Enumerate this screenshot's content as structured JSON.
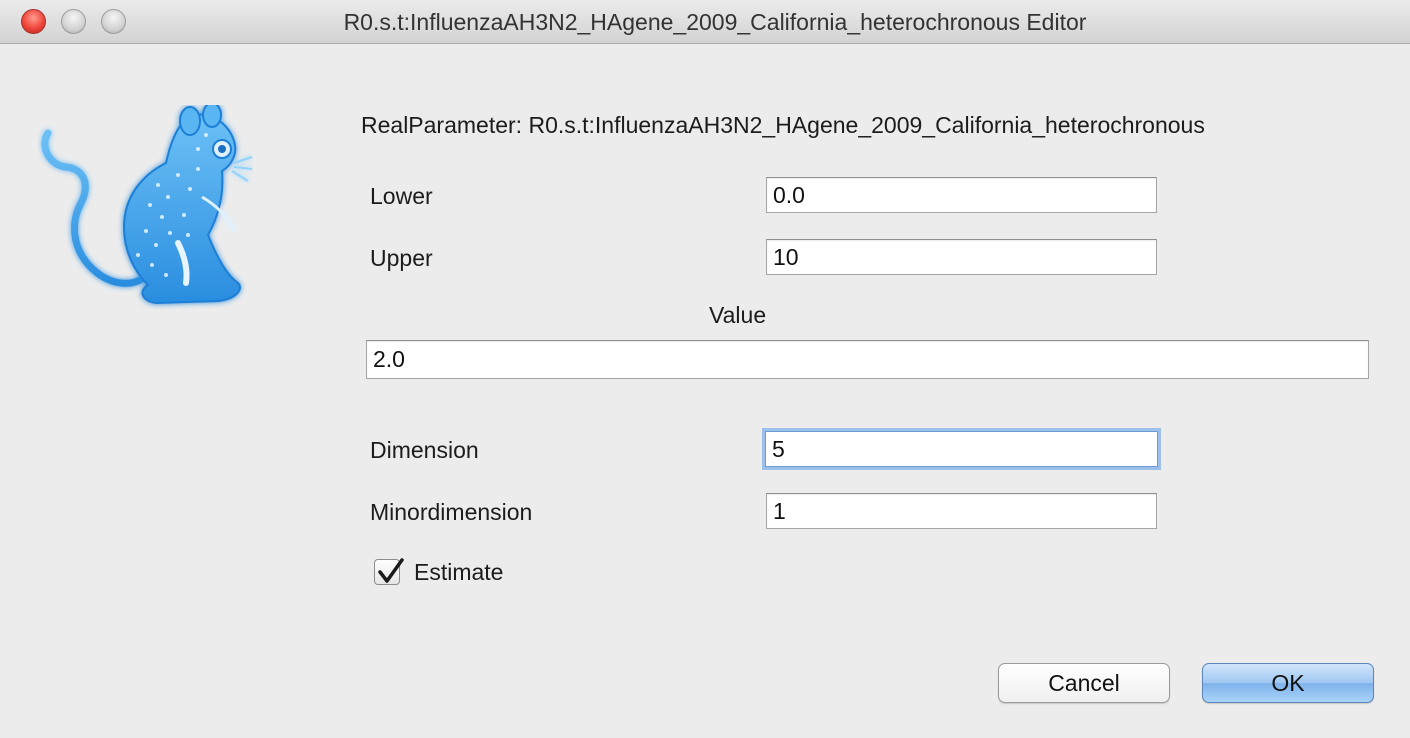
{
  "window": {
    "title": "R0.s.t:InfluenzaAH3N2_HAgene_2009_California_heterochronous Editor",
    "controls": [
      "close-icon",
      "minimize-icon",
      "zoom-icon"
    ]
  },
  "logo": {
    "icon": "beast-mouse-logo-icon",
    "color": "#3aa0ec"
  },
  "form": {
    "heading": "RealParameter: R0.s.t:InfluenzaAH3N2_HAgene_2009_California_heterochronous",
    "lower": {
      "label": "Lower",
      "value": "0.0"
    },
    "upper": {
      "label": "Upper",
      "value": "10"
    },
    "value": {
      "label": "Value",
      "value": "2.0"
    },
    "dimension": {
      "label": "Dimension",
      "value": "5"
    },
    "minordimension": {
      "label": "Minordimension",
      "value": "1"
    },
    "estimate": {
      "label": "Estimate",
      "checked": true
    }
  },
  "buttons": {
    "cancel": "Cancel",
    "ok": "OK"
  },
  "colors": {
    "accent": "#7fb3ec",
    "focus": "#9cc0ea"
  }
}
